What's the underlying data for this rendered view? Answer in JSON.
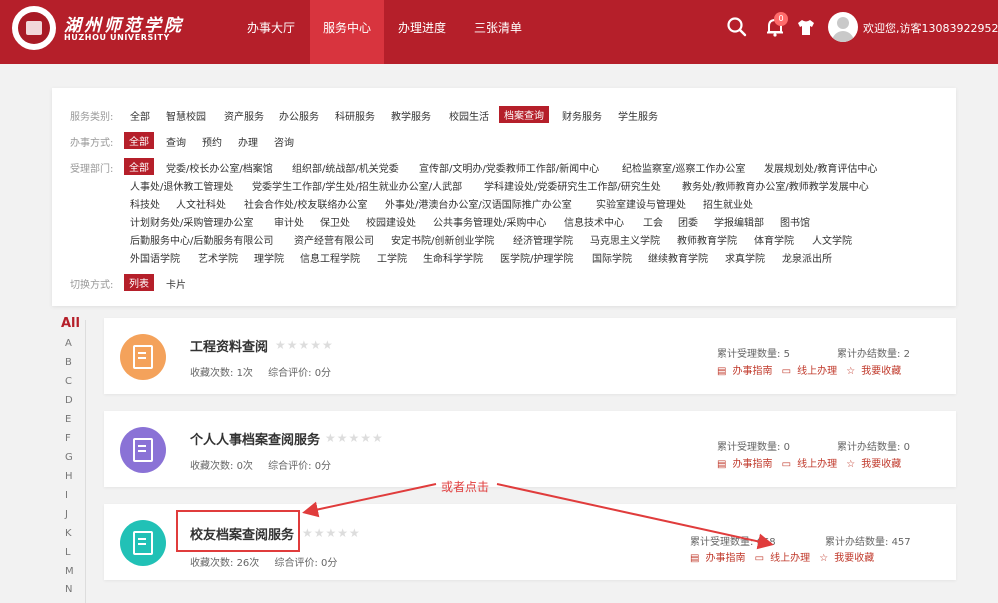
{
  "header": {
    "logo_cn": "湖州师范学院",
    "logo_en": "HUZHOU UNIVERSITY",
    "nav": [
      "办事大厅",
      "服务中心",
      "办理进度",
      "三张清单"
    ],
    "active_nav": "服务中心",
    "notification_count": "0",
    "welcome": "欢迎您,访客13083922952"
  },
  "filter": {
    "category_label": "服务类别:",
    "categories": [
      "全部",
      "智慧校园",
      "资产服务",
      "办公服务",
      "科研服务",
      "教学服务",
      "校园生活",
      "档案查询",
      "财务服务",
      "学生服务"
    ],
    "method_label": "办事方式:",
    "methods": [
      "全部",
      "查询",
      "预约",
      "办理",
      "咨询"
    ],
    "dept_label": "受理部门:",
    "depts": [
      [
        "全部",
        "党委/校长办公室/档案馆",
        "组织部/统战部/机关党委",
        "宣传部/文明办/党委教师工作部/新闻中心",
        "纪检监察室/巡察工作办公室",
        "发展规划处/教育评估中心"
      ],
      [
        "人事处/退休教工管理处",
        "党委学生工作部/学生处/招生就业办公室/人武部",
        "学科建设处/党委研究生工作部/研究生处",
        "教务处/教师教育办公室/教师教学发展中心"
      ],
      [
        "科技处",
        "人文社科处",
        "社会合作处/校友联络办公室",
        "外事处/港澳台办公室/汉语国际推广办公室",
        "实验室建设与管理处",
        "招生就业处"
      ],
      [
        "计划财务处/采购管理办公室",
        "审计处",
        "保卫处",
        "校园建设处",
        "公共事务管理处/采购中心",
        "信息技术中心",
        "工会",
        "团委",
        "学报编辑部",
        "图书馆"
      ],
      [
        "后勤服务中心/后勤服务有限公司",
        "资产经营有限公司",
        "安定书院/创新创业学院",
        "经济管理学院",
        "马克思主义学院",
        "教师教育学院",
        "体育学院",
        "人文学院"
      ],
      [
        "外国语学院",
        "艺术学院",
        "理学院",
        "信息工程学院",
        "工学院",
        "生命科学学院",
        "医学院/护理学院",
        "国际学院",
        "继续教育学院",
        "求真学院",
        "龙泉派出所"
      ]
    ],
    "view_label": "切换方式:",
    "views": [
      "列表",
      "卡片"
    ]
  },
  "alphabet": {
    "all": "All",
    "letters": [
      "A",
      "B",
      "C",
      "D",
      "E",
      "F",
      "G",
      "H",
      "I",
      "J",
      "K",
      "L",
      "M",
      "N"
    ]
  },
  "cards": [
    {
      "title": "工程资料查阅",
      "stars": "★★★★★",
      "favorites_label": "收藏次数:",
      "favorites": "1次",
      "rating_label": "综合评价:",
      "rating": "0分",
      "accepted_label": "累计受理数量:",
      "accepted": "5",
      "completed_label": "累计办结数量:",
      "completed": "2",
      "guide": "办事指南",
      "online": "线上办理",
      "collect": "我要收藏",
      "icon_color": "#f4a25b"
    },
    {
      "title": "个人人事档案查阅服务",
      "stars": "★★★★★",
      "favorites_label": "收藏次数:",
      "favorites": "0次",
      "rating_label": "综合评价:",
      "rating": "0分",
      "accepted_label": "累计受理数量:",
      "accepted": "0",
      "completed_label": "累计办结数量:",
      "completed": "0",
      "guide": "办事指南",
      "online": "线上办理",
      "collect": "我要收藏",
      "icon_color": "#8a72d6"
    },
    {
      "title": "校友档案查阅服务",
      "stars": "★★★★★",
      "favorites_label": "收藏次数:",
      "favorites": "26次",
      "rating_label": "综合评价:",
      "rating": "0分",
      "accepted_label": "累计受理数量:",
      "accepted": "668",
      "completed_label": "累计办结数量:",
      "completed": "457",
      "guide": "办事指南",
      "online": "线上办理",
      "collect": "我要收藏",
      "icon_color": "#21c1b6"
    }
  ],
  "annotation": {
    "text": "或者点击",
    "color": "#e03c3c"
  },
  "colors": {
    "brand": "#b51f2a",
    "brand_active": "#d8343e"
  }
}
